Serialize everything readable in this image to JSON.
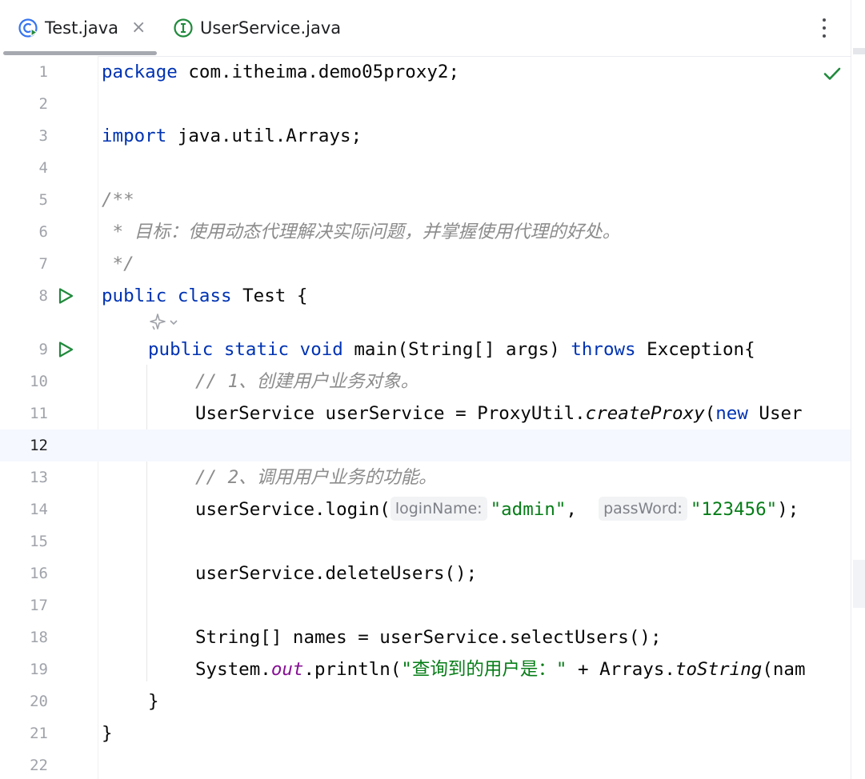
{
  "tabs": [
    {
      "label": "Test.java",
      "active": true,
      "closable": true,
      "icon": "java-class-run-icon"
    },
    {
      "label": "UserService.java",
      "active": false,
      "closable": false,
      "icon": "interface-icon"
    }
  ],
  "tab_close_glyph": "×",
  "colors": {
    "keyword": "#0033b3",
    "comment": "#8c8c8c",
    "string": "#067d17",
    "static_field": "#871094",
    "run_icon": "#208a3c",
    "current_line": "#f5f8fe"
  },
  "current_line": 12,
  "line_numbers": [
    "1",
    "2",
    "3",
    "4",
    "5",
    "6",
    "7",
    "8",
    "9",
    "10",
    "11",
    "12",
    "13",
    "14",
    "15",
    "16",
    "17",
    "18",
    "19",
    "20",
    "21",
    "22"
  ],
  "code": {
    "l1": {
      "kw": "package",
      "rest": " com.itheima.demo05proxy2;"
    },
    "l3": {
      "kw": "import",
      "rest": " java.util.Arrays;"
    },
    "l5": {
      "text": "/**"
    },
    "l6": {
      "text": " * 目标：使用动态代理解决实际问题，并掌握使用代理的好处。"
    },
    "l7": {
      "text": " */"
    },
    "l8": {
      "kw1": "public",
      "kw2": "class",
      "rest": " Test {"
    },
    "l9": {
      "kw1": "public",
      "kw2": "static",
      "kw3": "void",
      "mid": " main(String[] args) ",
      "kw4": "throws",
      "rest": " Exception{"
    },
    "l10": {
      "text": "// 1、创建用户业务对象。"
    },
    "l11": {
      "pre": "UserService userService = ProxyUtil.",
      "call": "createProxy",
      "paren": "(",
      "kw": "new",
      "rest": " User"
    },
    "l13": {
      "text": "// 2、调用用户业务的功能。"
    },
    "l14": {
      "pre": "userService.login(",
      "hint1": "loginName:",
      "arg1": "\"admin\"",
      "comma": ",  ",
      "hint2": "passWord:",
      "arg2": "\"123456\"",
      "post": ");"
    },
    "l16": {
      "text": "userService.deleteUsers();"
    },
    "l18": {
      "text": "String[] names = userService.selectUsers();"
    },
    "l19": {
      "pre": "System.",
      "fld": "out",
      "mid": ".println(",
      "str": "\"查询到的用户是：\"",
      "plus": " + Arrays.",
      "call": "toString",
      "rest": "(nam"
    },
    "l20": {
      "text": "}"
    },
    "l21": {
      "text": "}"
    }
  },
  "icons": {
    "run_gutter": "run-triangle-icon",
    "inspection_ok": "checkmark-icon",
    "ai_hint": "ai-assistant-icon",
    "more_menu": "kebab-menu-icon"
  }
}
